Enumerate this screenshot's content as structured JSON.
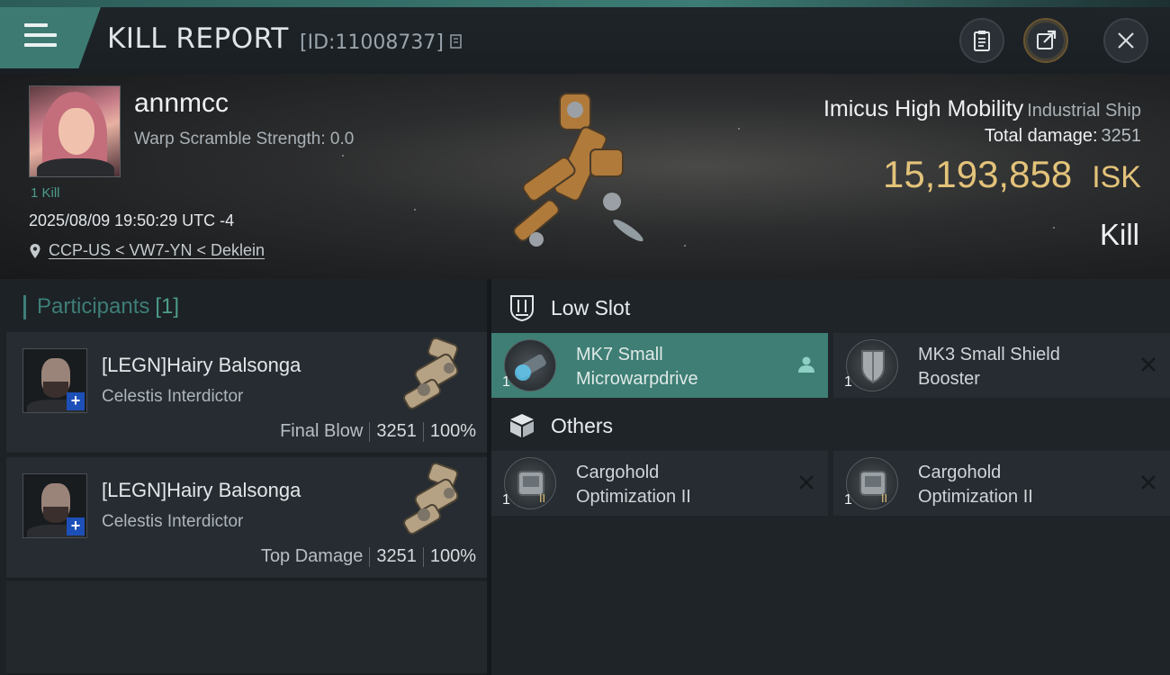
{
  "header": {
    "title": "KILL REPORT",
    "report_id": "[ID:11008737]"
  },
  "victim": {
    "name": "annmcc",
    "warp_scramble": "Warp Scramble Strength: 0.0",
    "kills": "1 Kill",
    "datetime": "2025/08/09 19:50:29 UTC -4",
    "location": "CCP-US < VW7-YN < Deklein",
    "ship_name": "Imicus High Mobility",
    "ship_class": "Industrial Ship",
    "total_damage_label": "Total damage:",
    "total_damage_value": "3251",
    "isk_value": "15,193,858",
    "isk_unit": "ISK",
    "result": "Kill"
  },
  "participants": {
    "title": "Participants",
    "count": "[1]",
    "rows": [
      {
        "name": "[LEGN]Hairy Balsonga",
        "ship": "Celestis Interdictor",
        "tag": "Final Blow",
        "damage": "3251",
        "percent": "100%"
      },
      {
        "name": "[LEGN]Hairy Balsonga",
        "ship": "Celestis Interdictor",
        "tag": "Top Damage",
        "damage": "3251",
        "percent": "100%"
      }
    ]
  },
  "fittings": {
    "low_slot_title": "Low Slot",
    "others_title": "Others",
    "low_slot": [
      {
        "qty": "1",
        "line1": "MK7 Small",
        "line2": "Microwarpdrive",
        "icon": "microwarpdrive-icon",
        "action": "pilot-icon"
      },
      {
        "qty": "1",
        "line1": "MK3 Small Shield",
        "line2": "Booster",
        "icon": "shield-booster-icon",
        "action": "destroyed-icon"
      }
    ],
    "others": [
      {
        "qty": "1",
        "line1": "Cargohold",
        "line2": "Optimization II",
        "icon": "cargohold-rig-icon",
        "action": "destroyed-icon"
      },
      {
        "qty": "1",
        "line1": "Cargohold",
        "line2": "Optimization II",
        "icon": "cargohold-rig-icon",
        "action": "destroyed-icon"
      }
    ]
  },
  "colors": {
    "accent_teal": "#3e7e74",
    "isk_gold": "#e3c37a",
    "background": "#15191d"
  }
}
